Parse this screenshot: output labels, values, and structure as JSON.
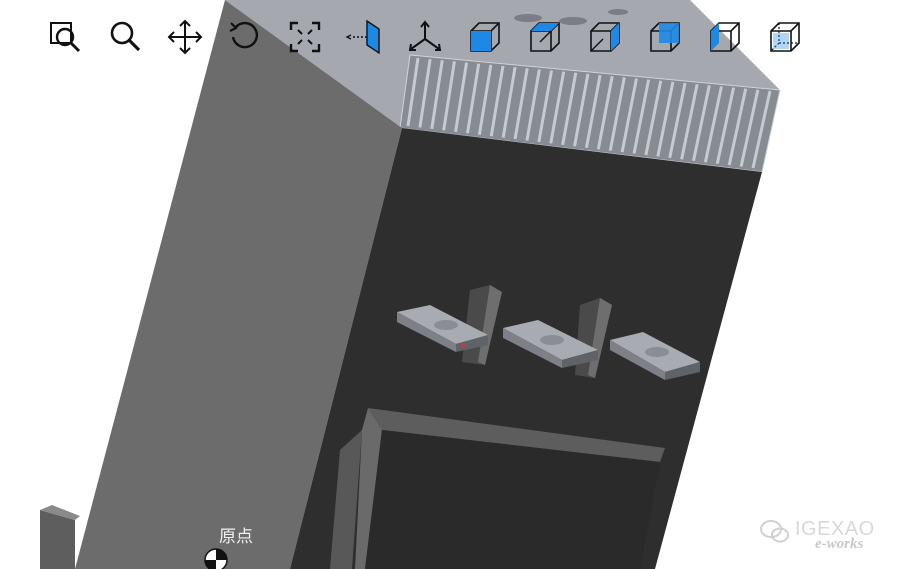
{
  "viewport": {
    "origin_label": "原点"
  },
  "toolbar": {
    "tools": [
      {
        "icon": "zoom-window-icon"
      },
      {
        "icon": "zoom-icon"
      },
      {
        "icon": "pan-icon"
      },
      {
        "icon": "rotate-icon"
      },
      {
        "icon": "fit-all-icon"
      },
      {
        "icon": "section-view-icon"
      },
      {
        "icon": "triad-icon"
      },
      {
        "icon": "view-front-icon"
      },
      {
        "icon": "view-top-icon"
      },
      {
        "icon": "view-right-icon"
      },
      {
        "icon": "view-back-icon"
      },
      {
        "icon": "view-left-icon"
      },
      {
        "icon": "view-isometric-icon"
      }
    ]
  },
  "watermark": {
    "brand": "IGEXAO",
    "sub": "e-works"
  },
  "colors": {
    "icon_stroke": "#111111",
    "icon_accent": "#1e88e5",
    "model_front_face": "#2f2f2f",
    "model_side_face": "#6a6a6a",
    "model_top_face": "#a0a4aa"
  }
}
